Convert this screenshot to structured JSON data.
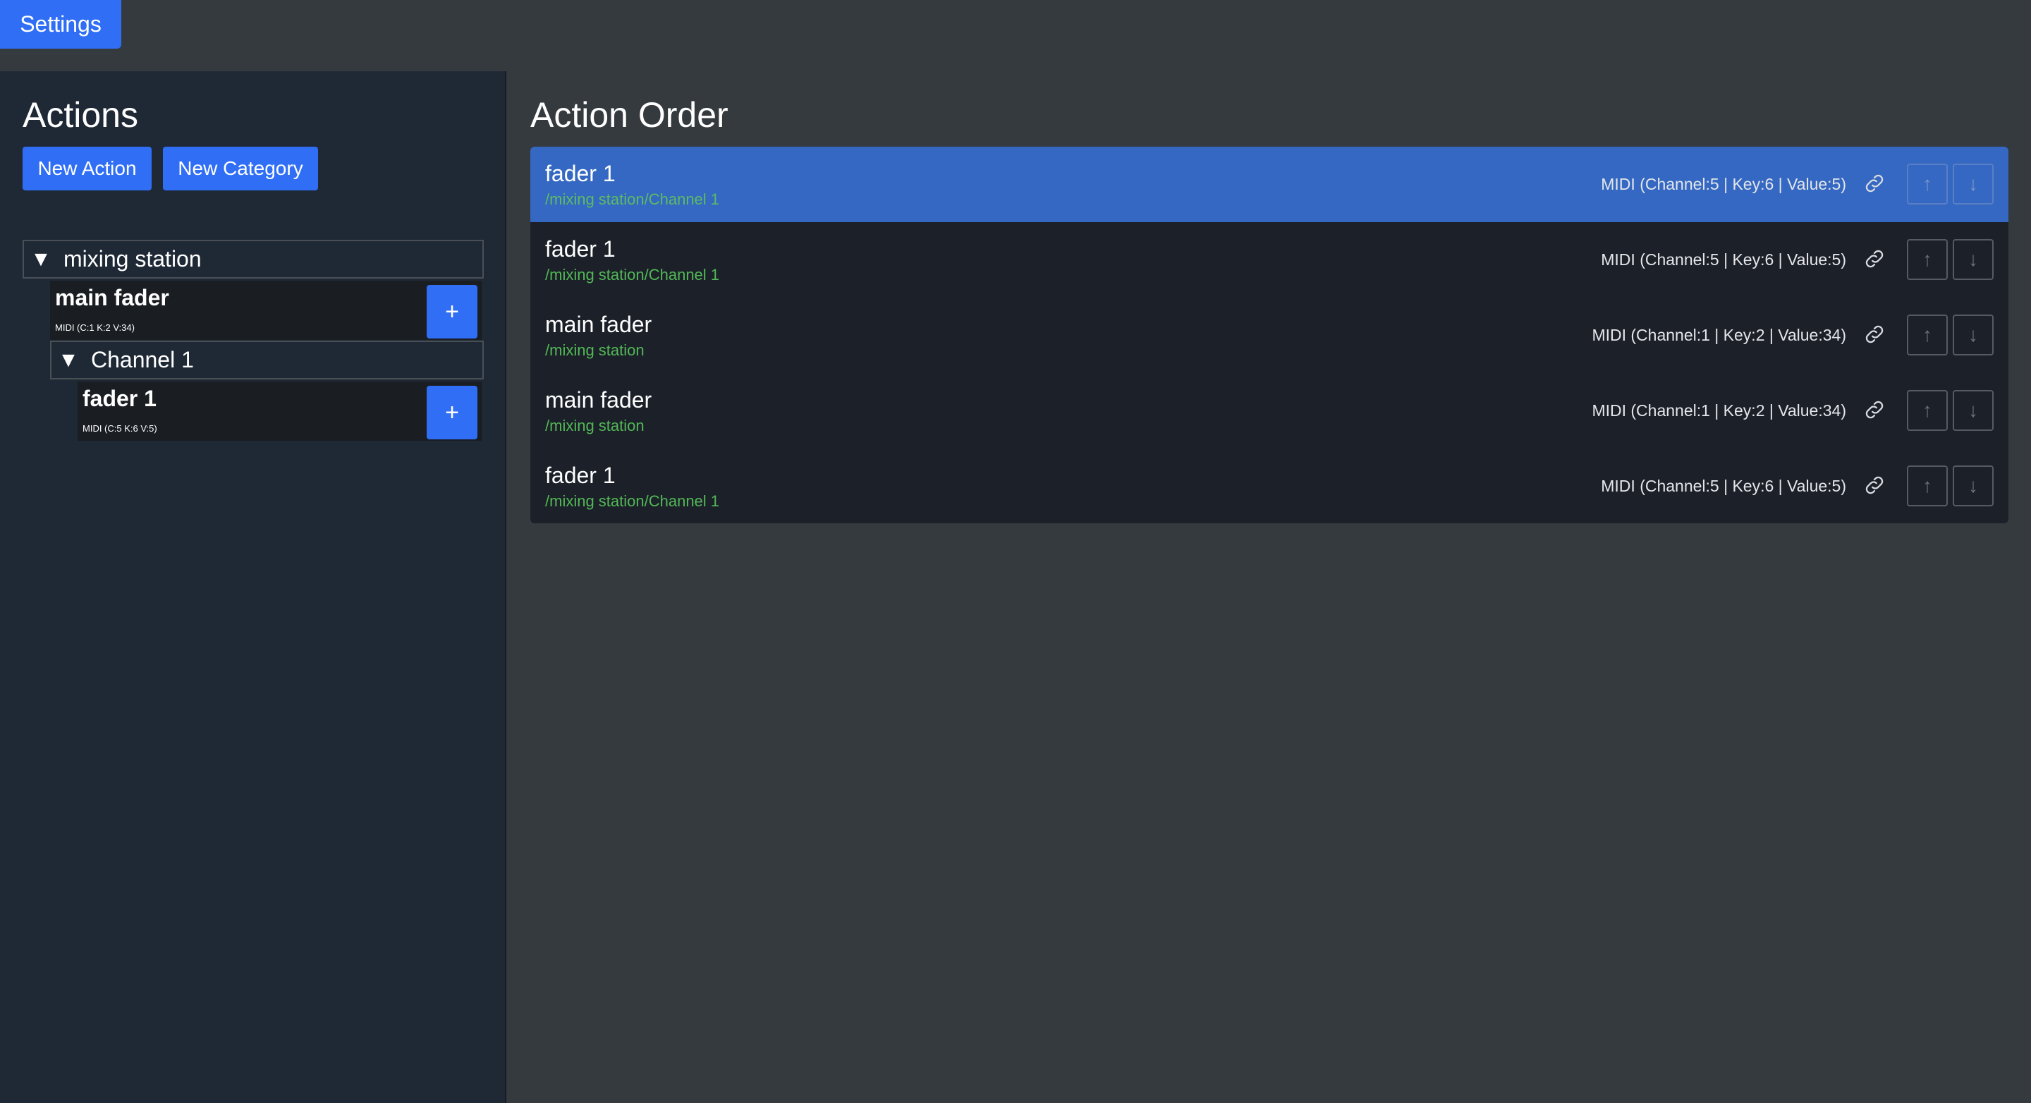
{
  "toolbar": {
    "settings_label": "Settings"
  },
  "sidebar": {
    "title": "Actions",
    "new_action_label": "New Action",
    "new_category_label": "New Category",
    "tree": {
      "category": {
        "label": "mixing station",
        "expanded": true
      },
      "action_main": {
        "name": "main fader",
        "midi": "MIDI (C:1 K:2 V:34)",
        "add_label": "+"
      },
      "subcategory": {
        "label": "Channel 1",
        "expanded": true
      },
      "action_fader": {
        "name": "fader 1",
        "midi": "MIDI (C:5 K:6 V:5)",
        "add_label": "+"
      },
      "expanded_glyph": "▼"
    }
  },
  "main": {
    "title": "Action Order",
    "rows": [
      {
        "name": "fader 1",
        "path": "/mixing station/Channel 1",
        "midi": "MIDI (Channel:5 | Key:6 | Value:5)",
        "selected": true
      },
      {
        "name": "fader 1",
        "path": "/mixing station/Channel 1",
        "midi": "MIDI (Channel:5 | Key:6 | Value:5)",
        "selected": false
      },
      {
        "name": "main fader",
        "path": "/mixing station",
        "midi": "MIDI (Channel:1 | Key:2 | Value:34)",
        "selected": false
      },
      {
        "name": "main fader",
        "path": "/mixing station",
        "midi": "MIDI (Channel:1 | Key:2 | Value:34)",
        "selected": false
      },
      {
        "name": "fader 1",
        "path": "/mixing station/Channel 1",
        "midi": "MIDI (Channel:5 | Key:6 | Value:5)",
        "selected": false
      }
    ],
    "up_glyph": "↑",
    "down_glyph": "↓"
  },
  "colors": {
    "accent": "#2f6ef5",
    "selected_row": "#3468c2",
    "path_green": "#52b856",
    "background": "#353a3f",
    "sidebar_bg": "#1f2936"
  }
}
